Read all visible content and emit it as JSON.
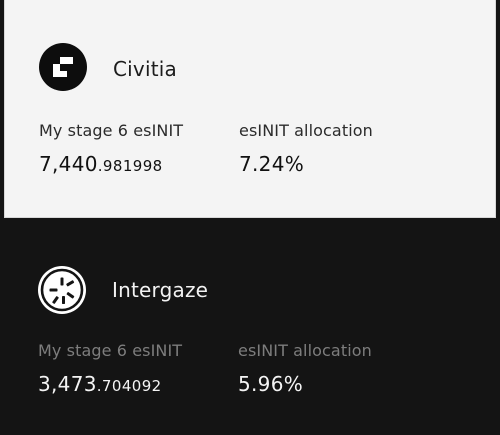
{
  "validators": [
    {
      "name": "Civitia",
      "logo_icon": "civitia-logo-icon",
      "stake_label": "My stage 6 esINIT",
      "stake_whole": "7,440",
      "stake_decimals": ".981998",
      "allocation_label": "esINIT allocation",
      "allocation_value": "7.24%"
    },
    {
      "name": "Intergaze",
      "logo_icon": "intergaze-logo-icon",
      "stake_label": "My stage 6 esINIT",
      "stake_whole": "3,473",
      "stake_decimals": ".704092",
      "allocation_label": "esINIT allocation",
      "allocation_value": "5.96%"
    }
  ],
  "colors": {
    "background": "#141414",
    "light_card": "#f4f4f4",
    "muted_label": "#7d7d7d"
  }
}
